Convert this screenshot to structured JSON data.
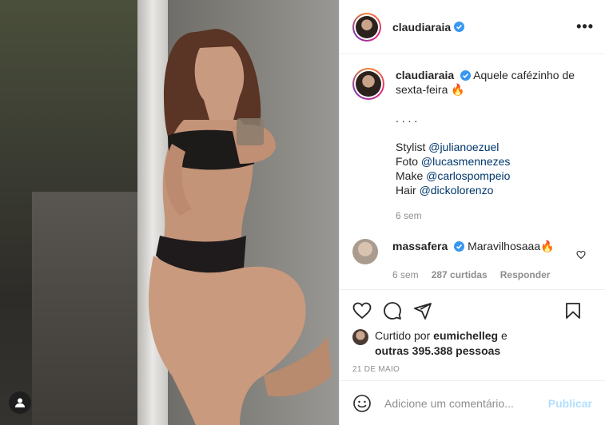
{
  "post": {
    "username": "claudiaraia",
    "verified": true,
    "more_label": "•••"
  },
  "caption": {
    "username": "claudiaraia",
    "text": "Aquele cafézinho de sexta-feira 🔥",
    "dots": ". . . .",
    "credits": [
      {
        "role": "Stylist",
        "handle": "@julianoezuel"
      },
      {
        "role": "Foto",
        "handle": "@lucasmennezes"
      },
      {
        "role": "Make",
        "handle": "@carlospompeio"
      },
      {
        "role": "Hair",
        "handle": "@dickolorenzo"
      }
    ],
    "time": "6 sem"
  },
  "comment": {
    "username": "massafera",
    "text": "Maravilhosaaa🔥",
    "time": "6 sem",
    "likes": "287 curtidas",
    "reply": "Responder"
  },
  "likes": {
    "prefix": "Curtido por",
    "user": "eumichelleg",
    "joiner": "e",
    "others": "outras 395.388 pessoas"
  },
  "date": "21 DE MAIO",
  "add_comment": {
    "placeholder": "Adicione um comentário...",
    "publish_label": "Publicar"
  },
  "colors": {
    "verified": "#3897f0",
    "mention": "#00376b",
    "muted": "#8e8e8e",
    "publish_disabled": "#b2dffc"
  },
  "icons": [
    "user-icon",
    "heart-icon",
    "comment-icon",
    "share-icon",
    "bookmark-icon",
    "emoji-icon",
    "more-icon",
    "verified-icon"
  ]
}
